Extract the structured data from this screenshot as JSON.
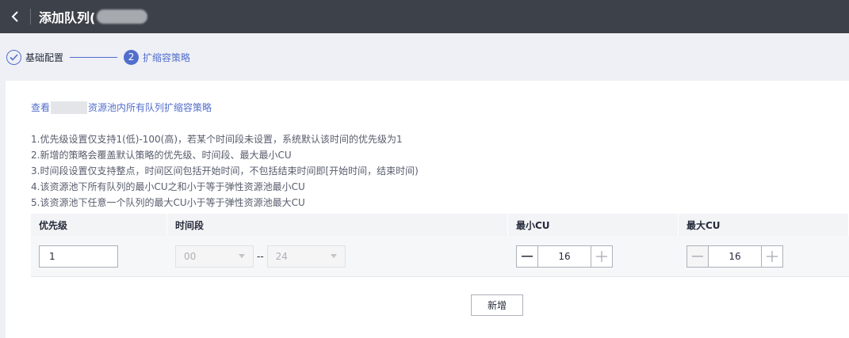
{
  "header": {
    "back_icon": "chevron-left-icon",
    "title": "添加队列("
  },
  "steps": [
    {
      "label": "基础配置",
      "state": "done",
      "icon": "check-circle-icon"
    },
    {
      "number": "2",
      "label": "扩缩容策略",
      "state": "active"
    }
  ],
  "colors": {
    "accent": "#526ecc",
    "header_bg": "#3d4149"
  },
  "panel": {
    "view_link_prefix": "查看",
    "view_link_suffix": "资源池内所有队列扩缩容策略",
    "notes": [
      "1.优先级设置仅支持1(低)-100(高)，若某个时间段未设置，系统默认该时间的优先级为1",
      "2.新增的策略会覆盖默认策略的优先级、时间段、最大最小CU",
      "3.时间段设置仅支持整点，时间区间包括开始时间，不包括结束时间即[开始时间，结束时间)",
      "4.该资源池下所有队列的最小CU之和小于等于弹性资源池最小CU",
      "5.该资源池下任意一个队列的最大CU小于等于弹性资源池最大CU"
    ]
  },
  "table": {
    "headers": [
      "优先级",
      "时间段",
      "最小CU",
      "最大CU"
    ],
    "row": {
      "priority": "1",
      "time_start": "00",
      "time_sep": "--",
      "time_end": "24",
      "min_cu": "16",
      "max_cu": "16"
    }
  },
  "add_button": "新增"
}
